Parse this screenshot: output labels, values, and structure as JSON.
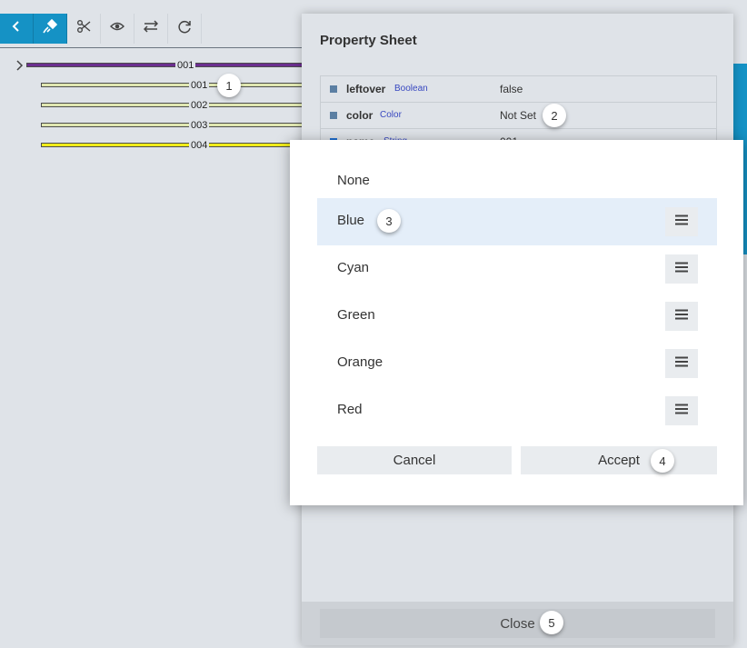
{
  "toolbar": {
    "buttons": [
      {
        "name": "back-button",
        "icon": "chevron-left-icon"
      },
      {
        "name": "auto-button",
        "icon": "plug-icon"
      },
      {
        "name": "cut-button",
        "icon": "scissors-icon"
      },
      {
        "name": "view-button",
        "icon": "eye-icon"
      },
      {
        "name": "swap-button",
        "icon": "swap-arrows-icon"
      },
      {
        "name": "refresh-button",
        "icon": "refresh-icon"
      }
    ],
    "active_color": "#1592c5"
  },
  "tree": {
    "root": {
      "label": "001",
      "color": "#6b2e8f"
    },
    "children": [
      {
        "label": "001",
        "color": "#dfe6b0"
      },
      {
        "label": "002",
        "color": "#dfe6b0"
      },
      {
        "label": "003",
        "color": "#dfe6b0"
      },
      {
        "label": "004",
        "color": "#f0ec1a"
      }
    ]
  },
  "property_sheet": {
    "title": "Property Sheet",
    "rows": [
      {
        "name": "leftover",
        "type": "Boolean",
        "value": "false"
      },
      {
        "name": "color",
        "type": "Color",
        "value": "Not Set"
      },
      {
        "name": "name",
        "type": "String",
        "value": "001"
      }
    ],
    "close_label": "Close"
  },
  "color_dialog": {
    "options": [
      {
        "label": "None",
        "selected": false,
        "has_menu": false
      },
      {
        "label": "Blue",
        "selected": true,
        "has_menu": true
      },
      {
        "label": "Cyan",
        "selected": false,
        "has_menu": true
      },
      {
        "label": "Green",
        "selected": false,
        "has_menu": true
      },
      {
        "label": "Orange",
        "selected": false,
        "has_menu": true
      },
      {
        "label": "Red",
        "selected": false,
        "has_menu": true
      }
    ],
    "cancel_label": "Cancel",
    "accept_label": "Accept",
    "selected_bg": "#e4eef9"
  },
  "badges": {
    "b1": "1",
    "b2": "2",
    "b3": "3",
    "b4": "4",
    "b5": "5"
  }
}
